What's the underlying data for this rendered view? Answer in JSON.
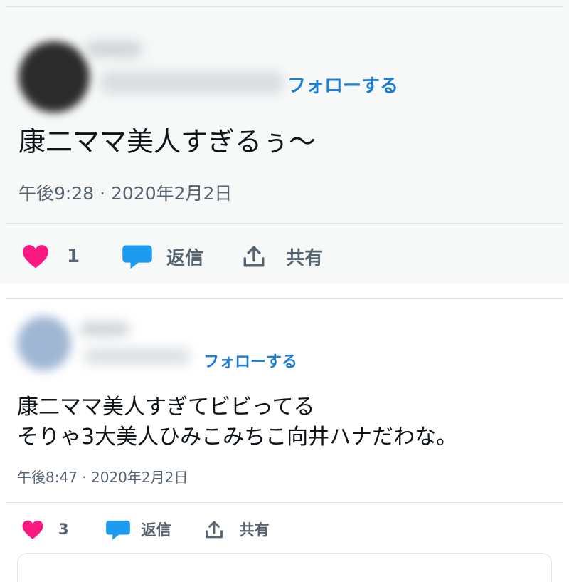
{
  "tweets": [
    {
      "follow_label": "フォローする",
      "text": "康二ママ美人すぎるぅ〜",
      "timestamp": "午後9:28 · 2020年2月2日",
      "likes": "1",
      "reply_label": "返信",
      "share_label": "共有"
    },
    {
      "follow_label": "フォローする",
      "text": "康二ママ美人すぎてビビってる\nそりゃ3大美人ひみこみちこ向井ハナだわな。",
      "timestamp": "午後8:47 · 2020年2月2日",
      "likes": "3",
      "reply_label": "返信",
      "share_label": "共有"
    }
  ],
  "icons": [
    "heart-icon",
    "reply-bubble-icon",
    "share-icon"
  ],
  "colors": {
    "follow": "#1d7dd3",
    "heart": "#f91880",
    "reply": "#1d9bf0",
    "meta": "#566370"
  }
}
